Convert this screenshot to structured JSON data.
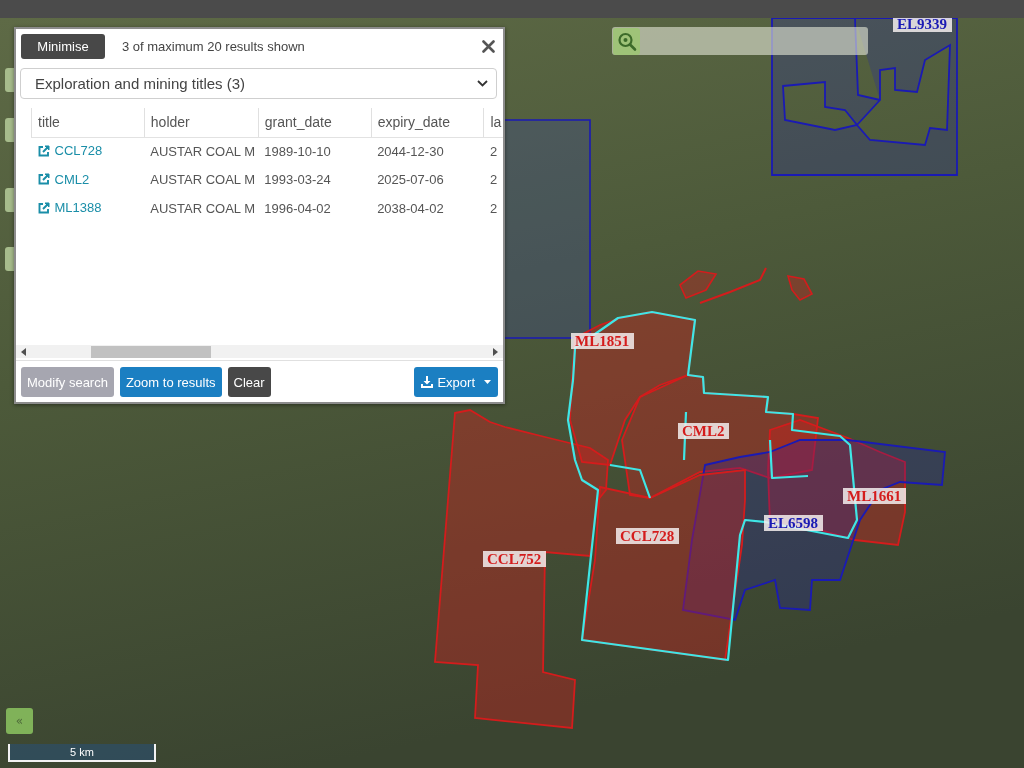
{
  "results_panel": {
    "minimise_button": "Minimise",
    "summary": "3 of maximum 20 results shown",
    "layer_select": {
      "value": "Exploration and mining titles (3)"
    },
    "table": {
      "columns": [
        "title",
        "holder",
        "grant_date",
        "expiry_date",
        "la"
      ],
      "rows": [
        {
          "cells": [
            "CCL728",
            "AUSTAR COAL M",
            "1989-10-10",
            "2044-12-30",
            "2"
          ]
        },
        {
          "cells": [
            "CML2",
            "AUSTAR COAL M",
            "1993-03-24",
            "2025-07-06",
            "2"
          ]
        },
        {
          "cells": [
            "ML1388",
            "AUSTAR COAL M",
            "1996-04-02",
            "2038-04-02",
            "2"
          ]
        }
      ]
    },
    "buttons": [
      {
        "label": "Modify search",
        "kind": "muted"
      },
      {
        "label": "Zoom to results",
        "kind": "primary"
      },
      {
        "label": "Clear",
        "kind": "dark"
      }
    ],
    "export_button": {
      "label": "Export"
    }
  },
  "map": {
    "features": [
      {
        "label": "EL9339",
        "color": "#1a1ab4"
      },
      {
        "label": "ML1851",
        "color": "#d41c1c"
      },
      {
        "label": "CML2",
        "color": "#d41c1c"
      },
      {
        "label": "ML1661",
        "color": "#d41c1c"
      },
      {
        "label": "EL6598",
        "color": "#1a1ab4"
      },
      {
        "label": "CCL728",
        "color": "#d41c1c"
      },
      {
        "label": "CCL752",
        "color": "#d41c1c"
      }
    ],
    "collapse_button": "«",
    "scale_bar": "5 km"
  }
}
